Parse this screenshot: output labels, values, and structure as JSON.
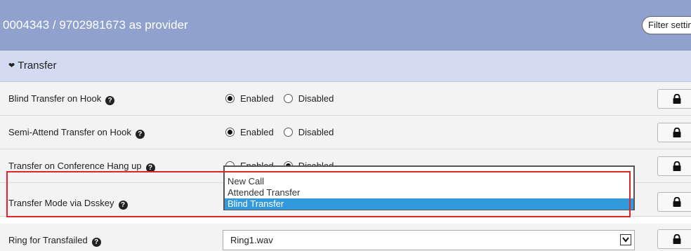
{
  "header": {
    "title": "0004343 / 9702981673 as provider",
    "filter_label": "Filter settings"
  },
  "section": {
    "title": "Transfer"
  },
  "rows": [
    {
      "label": "Blind Transfer on Hook",
      "radio_enabled": "Enabled",
      "radio_disabled": "Disabled",
      "selected": "Enabled"
    },
    {
      "label": "Semi-Attend Transfer on Hook",
      "radio_enabled": "Enabled",
      "radio_disabled": "Disabled",
      "selected": "Enabled"
    },
    {
      "label": "Transfer on Conference Hang up",
      "radio_enabled": "Enabled",
      "radio_disabled": "Disabled",
      "selected": "Disabled"
    },
    {
      "label": "Transfer Mode via Dsskey",
      "options": [
        "New Call",
        "Attended Transfer",
        "Blind Transfer"
      ],
      "selected": "Blind Transfer"
    },
    {
      "label": "Ring for Transfailed",
      "value": "Ring1.wav"
    }
  ],
  "colors": {
    "header_bg": "#8fa1cc",
    "section_bg": "#d2dbf1",
    "row_bg": "#f3f3f3",
    "selected_option": "#3399dd",
    "highlight": "#e0242b"
  },
  "icons": {
    "help": "question-circle-icon",
    "lock": "lock-icon",
    "chevron": "chevron-down-icon",
    "dropdown_arrow": "caret-down-icon"
  }
}
